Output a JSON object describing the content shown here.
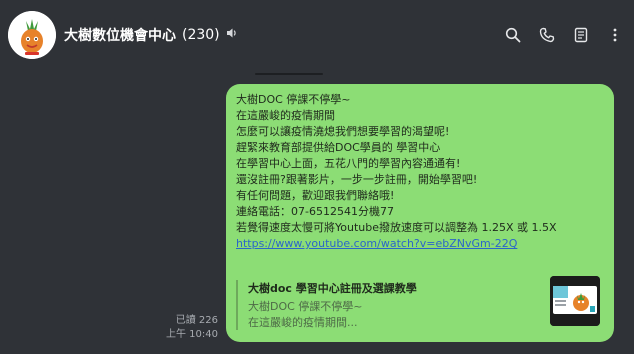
{
  "header": {
    "title": "大樹數位機會中心",
    "member_count": "(230)",
    "icons": [
      "speaker-icon",
      "search-icon",
      "phone-icon",
      "notes-icon",
      "menu-icon"
    ]
  },
  "message": {
    "lines": [
      "大樹DOC 停課不停學~",
      "在這嚴峻的疫情期間",
      "怎麼可以讓疫情澆熄我們想要學習的渴望呢!",
      "趕緊來教育部提供給DOC學員的 學習中心",
      "在學習中心上面，五花八門的學習內容通通有!",
      "還沒註冊?跟著影片，一步一步註冊，開始學習吧!",
      "有任何問題，歡迎跟我們聯絡哦!",
      "連絡電話：07-6512541分機77",
      "若覺得速度太慢可將Youtube撥放速度可以調整為 1.25X  或 1.5X"
    ],
    "link": "https://www.youtube.com/watch?v=ebZNvGm-22Q",
    "preview": {
      "title": "大樹doc 學習中心註冊及選課教學",
      "desc_line1": "大樹DOC 停課不停學~",
      "desc_line2": "在這嚴峻的疫情期間..."
    },
    "read_status": "已讀 226",
    "time": "上午 10:40"
  },
  "colors": {
    "background": "#2f3237",
    "bubble": "#8cdd75",
    "link": "#2b66c9",
    "meta_text": "#a7abb0"
  }
}
